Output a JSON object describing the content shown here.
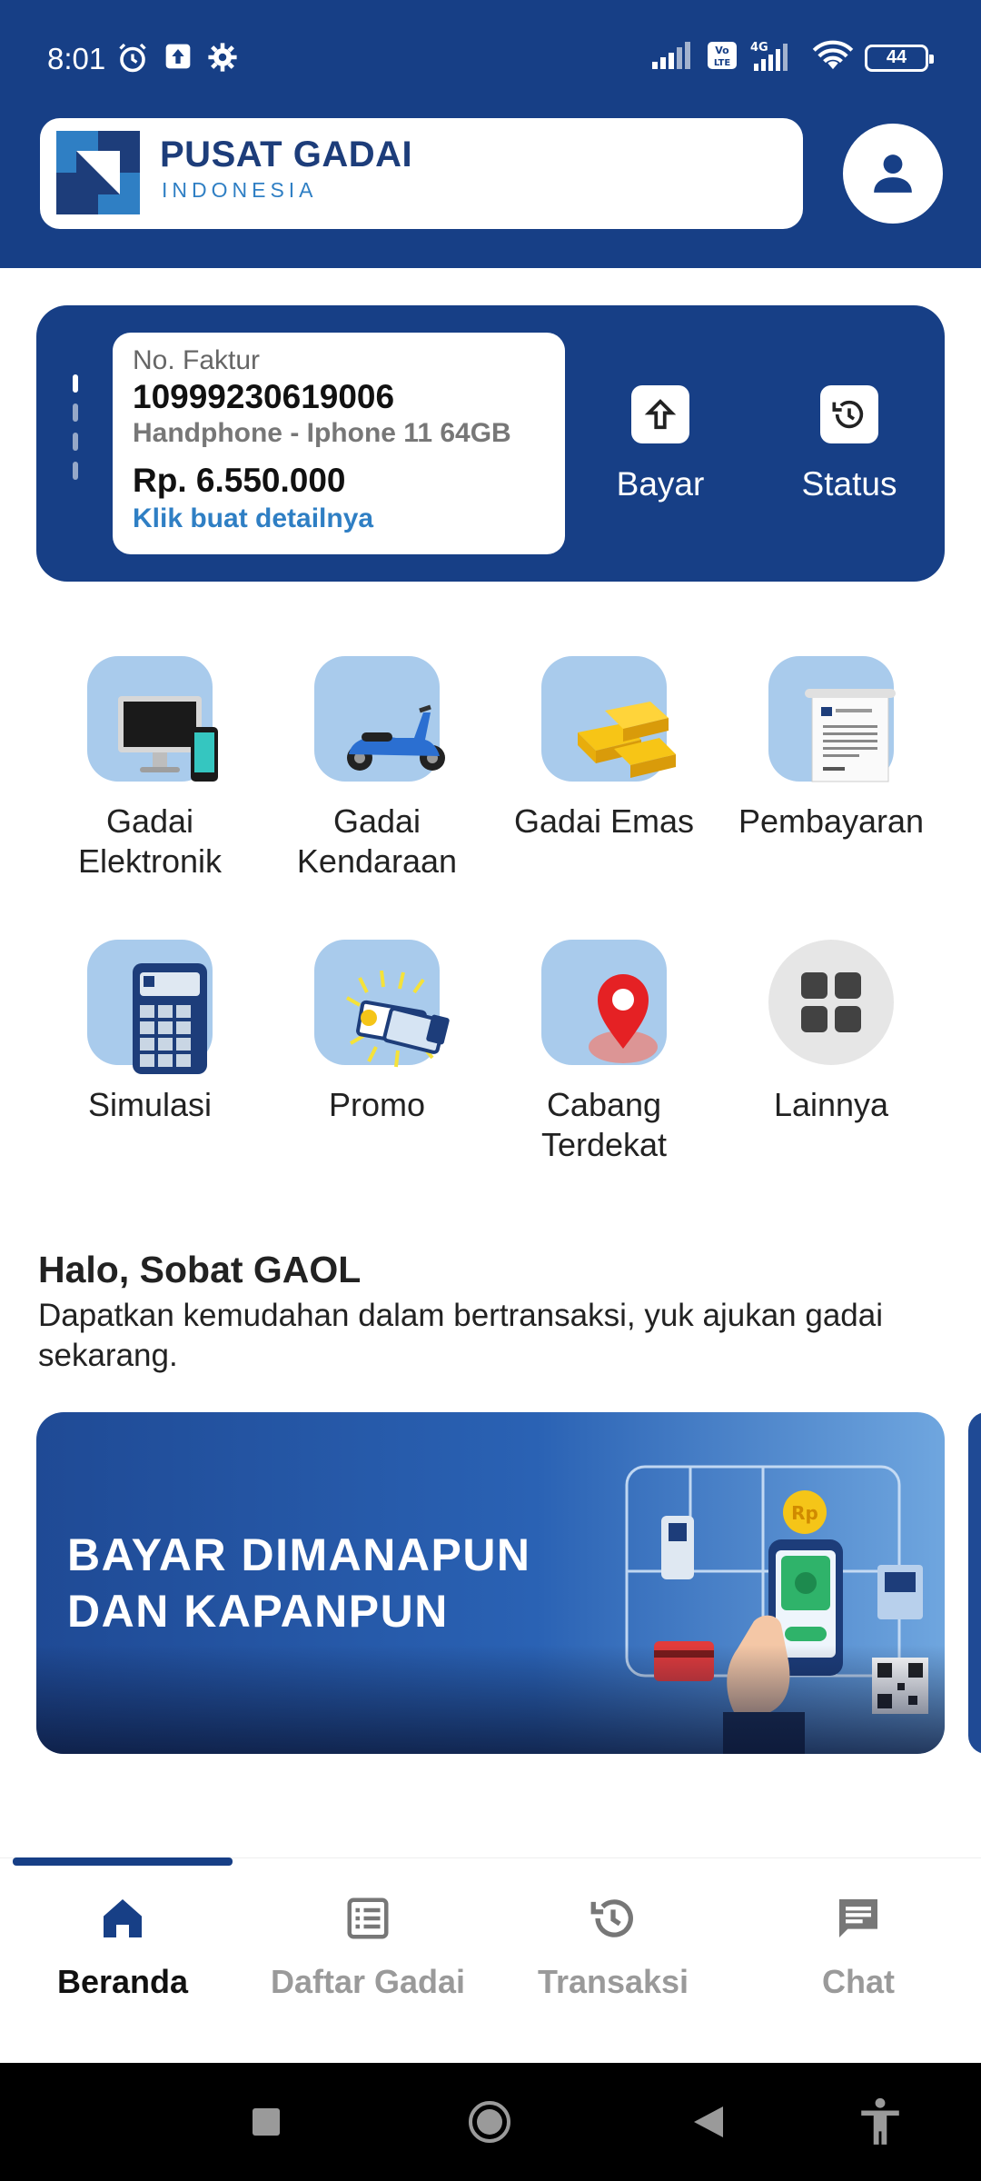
{
  "status_bar": {
    "time": "8:01",
    "battery": "44",
    "network": "4G"
  },
  "header": {
    "brand_title": "PUSAT GADAI",
    "brand_subtitle": "INDONESIA"
  },
  "invoice": {
    "label": "No. Faktur",
    "number": "10999230619006",
    "item": "Handphone - Iphone 11 64GB",
    "amount": "Rp. 6.550.000",
    "detail_link": "Klik buat detailnya",
    "actions": [
      {
        "label": "Bayar",
        "icon": "arrow-up-icon"
      },
      {
        "label": "Status",
        "icon": "history-icon"
      }
    ]
  },
  "menu": [
    {
      "label": "Gadai Elektronik",
      "icon": "electronics-icon"
    },
    {
      "label": "Gadai Kendaraan",
      "icon": "scooter-icon"
    },
    {
      "label": "Gadai Emas",
      "icon": "gold-bars-icon"
    },
    {
      "label": "Pembayaran",
      "icon": "receipt-icon"
    },
    {
      "label": "Simulasi",
      "icon": "calculator-icon"
    },
    {
      "label": "Promo",
      "icon": "promo-tickets-icon"
    },
    {
      "label": "Cabang Terdekat",
      "icon": "location-pin-icon"
    },
    {
      "label": "Lainnya",
      "icon": "grid-icon"
    }
  ],
  "greeting": {
    "title": "Halo, Sobat GAOL",
    "text": "Dapatkan kemudahan dalam bertransaksi, yuk ajukan gadai sekarang."
  },
  "banner": {
    "line1": "BAYAR DIMANAPUN",
    "line2": "DAN KAPANPUN"
  },
  "bottom_nav": [
    {
      "label": "Beranda",
      "icon": "home-icon",
      "active": true
    },
    {
      "label": "Daftar Gadai",
      "icon": "list-icon",
      "active": false
    },
    {
      "label": "Transaksi",
      "icon": "history-icon",
      "active": false
    },
    {
      "label": "Chat",
      "icon": "chat-icon",
      "active": false
    }
  ],
  "colors": {
    "primary": "#173f86",
    "accent": "#2f7fc4",
    "tile": "#a9cbec",
    "inactive": "#9a9a9a"
  }
}
